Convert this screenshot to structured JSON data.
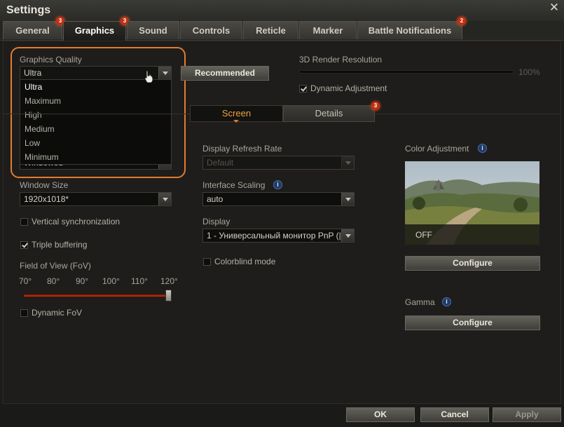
{
  "window": {
    "title": "Settings"
  },
  "tabs": [
    {
      "label": "General",
      "badge": "3"
    },
    {
      "label": "Graphics",
      "badge": "3"
    },
    {
      "label": "Sound",
      "badge": ""
    },
    {
      "label": "Controls",
      "badge": ""
    },
    {
      "label": "Reticle",
      "badge": ""
    },
    {
      "label": "Marker",
      "badge": ""
    },
    {
      "label": "Battle Notifications",
      "badge": "2"
    }
  ],
  "graphics_quality": {
    "label": "Graphics Quality",
    "selected": "Ultra",
    "options": [
      "Ultra",
      "Maximum",
      "High",
      "Medium",
      "Low",
      "Minimum"
    ],
    "hidden_below": "Windowed"
  },
  "recommended_label": "Recommended",
  "render_resolution": {
    "label": "3D Render Resolution",
    "value": "100%",
    "level": 1.0
  },
  "dynamic_adjustment": {
    "label": "Dynamic Adjustment",
    "checked": true
  },
  "subtabs": {
    "screen": "Screen",
    "details": "Details",
    "details_badge": "3"
  },
  "refresh_rate": {
    "label": "Display Refresh Rate",
    "value": "Default"
  },
  "interface_scaling": {
    "label": "Interface Scaling",
    "value": "auto"
  },
  "display": {
    "label": "Display",
    "value": "1 - Универсальный монитор PnP (|"
  },
  "colorblind": {
    "label": "Colorblind mode",
    "checked": false
  },
  "window_size": {
    "label": "Window Size",
    "value": "1920x1018*"
  },
  "vsync": {
    "label": "Vertical synchronization",
    "checked": false
  },
  "triple_buffering": {
    "label": "Triple buffering",
    "checked": true
  },
  "fov": {
    "label": "Field of View (FoV)",
    "ticks": [
      "70°",
      "80°",
      "90°",
      "100°",
      "110°",
      "120°"
    ],
    "value": 120
  },
  "dynamic_fov": {
    "label": "Dynamic FoV",
    "checked": false
  },
  "color_adjustment": {
    "label": "Color Adjustment",
    "preview_status": "OFF",
    "configure_label": "Configure"
  },
  "gamma": {
    "label": "Gamma",
    "configure_label": "Configure"
  },
  "footer": {
    "ok": "OK",
    "cancel": "Cancel",
    "apply": "Apply"
  },
  "colors": {
    "accent": "#e27b2f",
    "badge": "#c43010",
    "background": "#1e1d1b"
  }
}
